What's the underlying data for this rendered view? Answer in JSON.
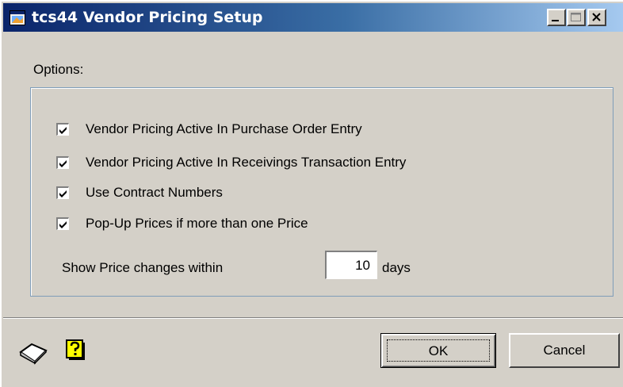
{
  "window": {
    "title": "tcs44 Vendor Pricing Setup",
    "title_icon": "window-app-icon",
    "controls": [
      "minimize",
      "maximize",
      "close"
    ]
  },
  "options": {
    "label": "Options:",
    "checkboxes": [
      {
        "label": "Vendor Pricing Active In Purchase Order Entry",
        "checked": true
      },
      {
        "label": "Vendor Pricing Active In Receivings Transaction Entry",
        "checked": true
      },
      {
        "label": "Use Contract Numbers",
        "checked": true
      },
      {
        "label": "Pop-Up Prices if more than one Price",
        "checked": true
      }
    ],
    "show_price_label": "Show Price changes within",
    "days_value": "10",
    "days_unit": "days"
  },
  "footer": {
    "note_icon": "note-icon",
    "help_icon": "help-icon",
    "ok_label": "OK",
    "cancel_label": "Cancel"
  },
  "colors": {
    "titlebar_start": "#0a246a",
    "titlebar_end": "#a6caf0",
    "dialog_bg": "#d4d0c8",
    "groupbox_border": "#7f9db9"
  }
}
